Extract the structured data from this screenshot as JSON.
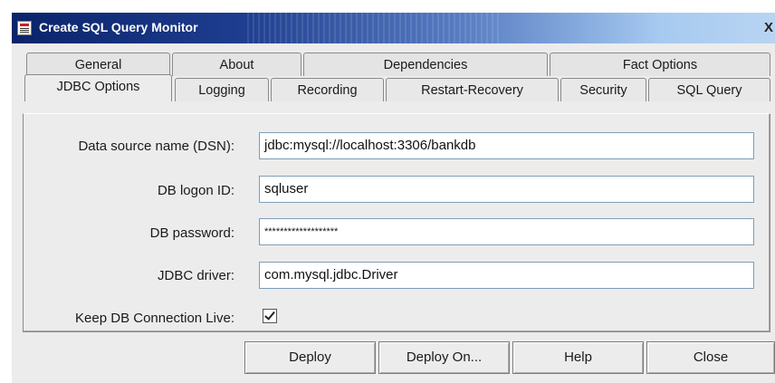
{
  "window": {
    "title": "Create SQL Query Monitor",
    "close_glyph": "X",
    "icon": "sql-monitor-icon"
  },
  "tabs": {
    "back_row": [
      "General",
      "About",
      "Dependencies",
      "Fact Options"
    ],
    "front_row": [
      "JDBC Options",
      "Logging",
      "Recording",
      "Restart-Recovery",
      "Security",
      "SQL Query"
    ],
    "active": "JDBC Options"
  },
  "form": {
    "dsn": {
      "label": "Data source name (DSN):",
      "value": "jdbc:mysql://localhost:3306/bankdb"
    },
    "logon": {
      "label": "DB logon ID:",
      "value": "sqluser"
    },
    "password": {
      "label": "DB password:",
      "value": "*******************"
    },
    "driver": {
      "label": "JDBC driver:",
      "value": "com.mysql.jdbc.Driver"
    },
    "keep_live": {
      "label": "Keep DB Connection Live:",
      "checked": true
    }
  },
  "buttons": {
    "deploy": "Deploy",
    "deploy_on": "Deploy On...",
    "help": "Help",
    "close": "Close"
  },
  "colors": {
    "title_gradient_start": "#0a246a",
    "title_gradient_end": "#b9d4f2",
    "dialog_bg": "#ececec",
    "field_border": "#7f9db9"
  }
}
